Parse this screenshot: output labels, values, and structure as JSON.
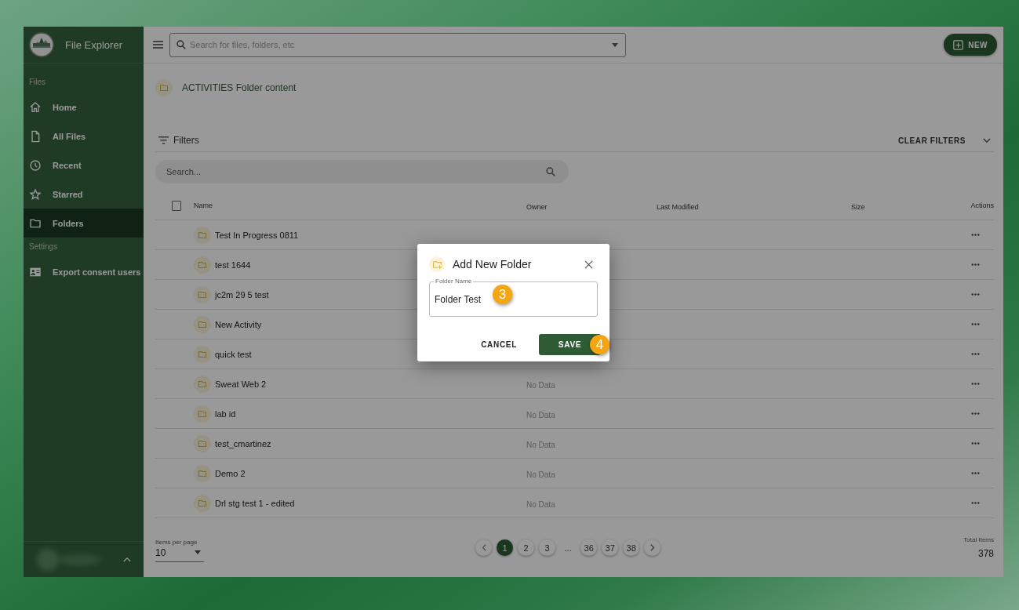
{
  "app": {
    "title": "File Explorer"
  },
  "sidebar": {
    "sections": [
      {
        "heading": "Files",
        "items": [
          {
            "label": "Home",
            "selected": false
          },
          {
            "label": "All Files",
            "selected": false
          },
          {
            "label": "Recent",
            "selected": false
          },
          {
            "label": "Starred",
            "selected": false
          },
          {
            "label": "Folders",
            "selected": true
          }
        ]
      },
      {
        "heading": "Settings",
        "items": [
          {
            "label": "Export consent users",
            "selected": false
          }
        ]
      }
    ]
  },
  "topbar": {
    "search": {
      "placeholder": "Search for files, folders, etc"
    },
    "new_button": "NEW"
  },
  "folder": {
    "title": "ACTIVITIES Folder content"
  },
  "filters": {
    "label": "Filters",
    "clear": "CLEAR FILTERS",
    "search": {
      "placeholder": "Search..."
    }
  },
  "table": {
    "select_all": {
      "checked": false
    },
    "columns": [
      "Name",
      "Owner",
      "Last Modified",
      "Size",
      "Actions"
    ],
    "rows": [
      {
        "name": "Test In Progress 0811"
      },
      {
        "name": "test 1644"
      },
      {
        "name": "jc2m 29 5 test"
      },
      {
        "name": "New Activity"
      },
      {
        "name": "quick test"
      },
      {
        "name": "Sweat Web 2",
        "owner": "No Data"
      },
      {
        "name": "lab id",
        "owner": "No Data"
      },
      {
        "name": "test_cmartinez",
        "owner": "No Data"
      },
      {
        "name": "Demo 2",
        "owner": "No Data"
      },
      {
        "name": "Drl stg test 1 - edited",
        "owner": "No Data"
      }
    ]
  },
  "pagination": {
    "items_per_page_label": "Items per page",
    "items_per_page": "10",
    "pages_start": [
      {
        "label": "1",
        "selected": true
      },
      {
        "label": "2",
        "selected": false
      },
      {
        "label": "3",
        "selected": false
      }
    ],
    "ellipsis": "...",
    "pages_end": [
      {
        "label": "36",
        "selected": false
      },
      {
        "label": "37",
        "selected": false
      },
      {
        "label": "38",
        "selected": false
      }
    ],
    "total_label": "Total Items",
    "total": "378"
  },
  "dialog": {
    "title": "Add New Folder",
    "field": {
      "label": "Folder Name",
      "value": "Folder Test",
      "step": "3"
    },
    "cancel": "CANCEL",
    "save": "SAVE",
    "save_step": "4"
  }
}
